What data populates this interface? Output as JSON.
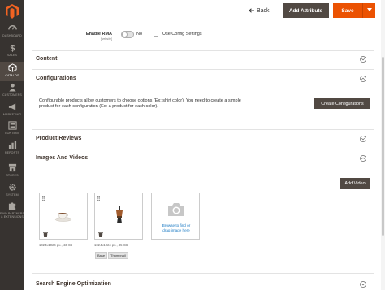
{
  "sidebar": {
    "items": [
      {
        "label": "DASHBOARD",
        "icon": "dashboard-icon"
      },
      {
        "label": "SALES",
        "icon": "dollar-icon"
      },
      {
        "label": "CATALOG",
        "icon": "cube-icon",
        "active": true
      },
      {
        "label": "CUSTOMERS",
        "icon": "person-icon"
      },
      {
        "label": "MARKETING",
        "icon": "megaphone-icon"
      },
      {
        "label": "CONTENT",
        "icon": "layout-icon"
      },
      {
        "label": "REPORTS",
        "icon": "bar-chart-icon"
      },
      {
        "label": "STORES",
        "icon": "store-icon"
      },
      {
        "label": "SYSTEM",
        "icon": "gear-icon"
      },
      {
        "label_line1": "FIND PARTNERS",
        "label_line2": "& EXTENSIONS",
        "icon": "puzzle-icon"
      }
    ]
  },
  "header": {
    "back_label": "Back",
    "add_attribute_label": "Add Attribute",
    "save_label": "Save"
  },
  "rma": {
    "label": "Enable RMA",
    "scope": "[website]",
    "toggle_value": "No",
    "use_config_label": "Use Config Settings"
  },
  "sections": {
    "content": "Content",
    "configurations": "Configurations",
    "product_reviews": "Product Reviews",
    "images_and_videos": "Images And Videos",
    "seo": "Search Engine Optimization"
  },
  "configurations": {
    "description": "Configurable products allow customers to choose options (Ex: shirt color). You need to create a simple product for each configuration (Ex: a product for each color).",
    "create_button": "Create Configurations"
  },
  "images": {
    "add_video_label": "Add Video",
    "items": [
      {
        "meta": "1024x1024 px., 43 KB",
        "roles": []
      },
      {
        "meta": "1024x1024 px., 45 KB",
        "roles": [
          "Base",
          "Thumbnail"
        ]
      }
    ],
    "upload_text_line1": "Browse to find or",
    "upload_text_line2": "drag image here"
  },
  "colors": {
    "sidebar_bg": "#373330",
    "accent": "#eb5202",
    "dark_button": "#514943",
    "link": "#1979c3"
  }
}
